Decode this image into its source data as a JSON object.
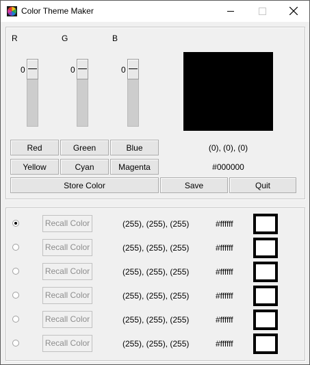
{
  "window": {
    "title": "Color Theme Maker"
  },
  "channels": [
    {
      "label": "R",
      "value": "0"
    },
    {
      "label": "G",
      "value": "0"
    },
    {
      "label": "B",
      "value": "0"
    }
  ],
  "preview": {
    "color": "#000000",
    "rgb_text": "(0), (0), (0)",
    "hex_text": "#000000"
  },
  "buttons": {
    "red": "Red",
    "green": "Green",
    "blue": "Blue",
    "yellow": "Yellow",
    "cyan": "Cyan",
    "magenta": "Magenta",
    "store": "Store Color",
    "save": "Save",
    "quit": "Quit"
  },
  "stored_colors": [
    {
      "selected": true,
      "recall_label": "Recall Color",
      "rgb": "(255), (255), (255)",
      "hex": "#ffffff",
      "color": "#ffffff"
    },
    {
      "selected": false,
      "recall_label": "Recall Color",
      "rgb": "(255), (255), (255)",
      "hex": "#ffffff",
      "color": "#ffffff"
    },
    {
      "selected": false,
      "recall_label": "Recall Color",
      "rgb": "(255), (255), (255)",
      "hex": "#ffffff",
      "color": "#ffffff"
    },
    {
      "selected": false,
      "recall_label": "Recall Color",
      "rgb": "(255), (255), (255)",
      "hex": "#ffffff",
      "color": "#ffffff"
    },
    {
      "selected": false,
      "recall_label": "Recall Color",
      "rgb": "(255), (255), (255)",
      "hex": "#ffffff",
      "color": "#ffffff"
    },
    {
      "selected": false,
      "recall_label": "Recall Color",
      "rgb": "(255), (255), (255)",
      "hex": "#ffffff",
      "color": "#ffffff"
    }
  ]
}
